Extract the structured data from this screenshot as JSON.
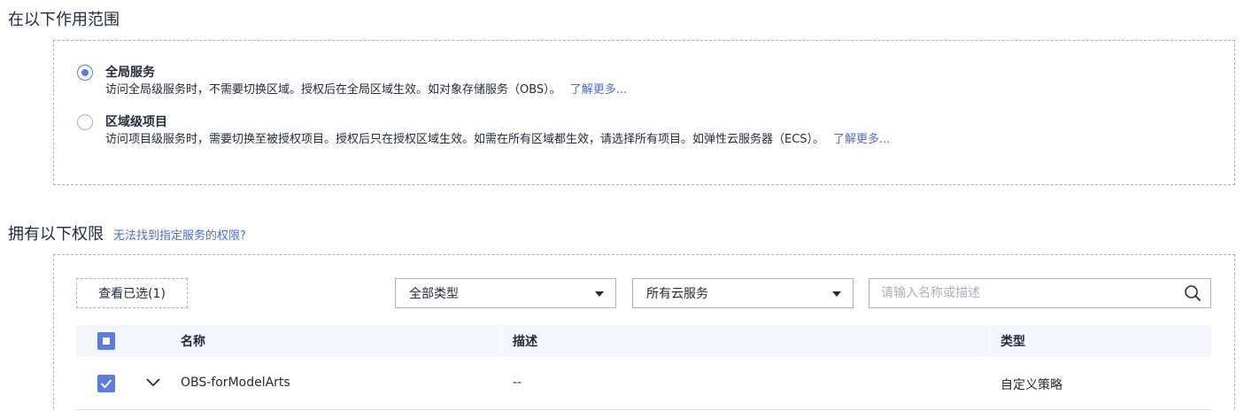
{
  "scope_section": {
    "title": "在以下作用范围",
    "options": [
      {
        "title": "全局服务",
        "description": "访问全局级服务时，不需要切换区域。授权后在全局区域生效。如对象存储服务（OBS）。",
        "link": "了解更多...",
        "selected": true
      },
      {
        "title": "区域级项目",
        "description": "访问项目级服务时，需要切换至被授权项目。授权后只在授权区域生效。如需在所有区域都生效，请选择所有项目。如弹性云服务器（ECS）。",
        "link": "了解更多...",
        "selected": false
      }
    ]
  },
  "permissions_section": {
    "title": "拥有以下权限",
    "help_link": "无法找到指定服务的权限?",
    "view_selected_button": "查看已选(1)",
    "type_filter": {
      "value": "全部类型"
    },
    "service_filter": {
      "value": "所有云服务"
    },
    "search": {
      "placeholder": "请输入名称或描述",
      "value": ""
    },
    "table": {
      "headers": {
        "name": "名称",
        "description": "描述",
        "type": "类型"
      },
      "rows": [
        {
          "name": "OBS-forModelArts",
          "description": "--",
          "type": "自定义策略",
          "checked": true
        }
      ]
    }
  },
  "colors": {
    "accent": "#5e7ce0",
    "link": "#526ecc",
    "header_bg": "#f3f6fe"
  }
}
